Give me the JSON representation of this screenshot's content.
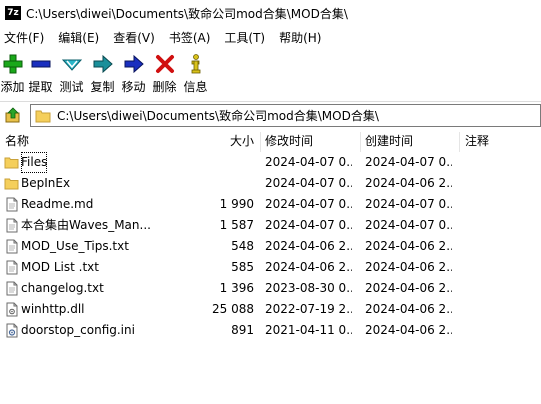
{
  "window": {
    "title": "C:\\Users\\diwei\\Documents\\致命公司mod合集\\MOD合集\\",
    "app_icon_text": "7z"
  },
  "menu": [
    {
      "label": "文件(F)"
    },
    {
      "label": "编辑(E)"
    },
    {
      "label": "查看(V)"
    },
    {
      "label": "书签(A)"
    },
    {
      "label": "工具(T)"
    },
    {
      "label": "帮助(H)"
    }
  ],
  "toolbar": [
    {
      "label": "添加",
      "icon": "add-icon",
      "color": "#1aa81a"
    },
    {
      "label": "提取",
      "icon": "extract-icon",
      "color": "#1a2fbf"
    },
    {
      "label": "测试",
      "icon": "test-icon",
      "color": "#29b6c9"
    },
    {
      "label": "复制",
      "icon": "copy-icon",
      "color": "#1a8f9a"
    },
    {
      "label": "移动",
      "icon": "move-icon",
      "color": "#1a2fbf"
    },
    {
      "label": "删除",
      "icon": "delete-icon",
      "color": "#d01010"
    },
    {
      "label": "信息",
      "icon": "info-icon",
      "color": "#d9c21a"
    }
  ],
  "address": {
    "path": "C:\\Users\\diwei\\Documents\\致命公司mod合集\\MOD合集\\"
  },
  "columns": {
    "name": "名称",
    "size": "大小",
    "modified": "修改时间",
    "created": "创建时间",
    "comment": "注释"
  },
  "files": [
    {
      "name": "Files",
      "size": "",
      "modified": "2024-04-07 0...",
      "created": "2024-04-07 0...",
      "type": "folder"
    },
    {
      "name": "BepInEx",
      "size": "",
      "modified": "2024-04-07 0...",
      "created": "2024-04-06 2...",
      "type": "folder"
    },
    {
      "name": "Readme.md",
      "size": "1 990",
      "modified": "2024-04-07 0...",
      "created": "2024-04-07 0...",
      "type": "file"
    },
    {
      "name": "本合集由Waves_Man...",
      "size": "1 587",
      "modified": "2024-04-07 0...",
      "created": "2024-04-07 0...",
      "type": "file"
    },
    {
      "name": "MOD_Use_Tips.txt",
      "size": "548",
      "modified": "2024-04-06 2...",
      "created": "2024-04-06 2...",
      "type": "file"
    },
    {
      "name": "MOD List .txt",
      "size": "585",
      "modified": "2024-04-06 2...",
      "created": "2024-04-06 2...",
      "type": "file"
    },
    {
      "name": "changelog.txt",
      "size": "1 396",
      "modified": "2023-08-30 0...",
      "created": "2024-04-06 2...",
      "type": "file"
    },
    {
      "name": "winhttp.dll",
      "size": "25 088",
      "modified": "2022-07-19 2...",
      "created": "2024-04-06 2...",
      "type": "dll"
    },
    {
      "name": "doorstop_config.ini",
      "size": "891",
      "modified": "2021-04-11 0...",
      "created": "2024-04-06 2...",
      "type": "ini"
    }
  ]
}
